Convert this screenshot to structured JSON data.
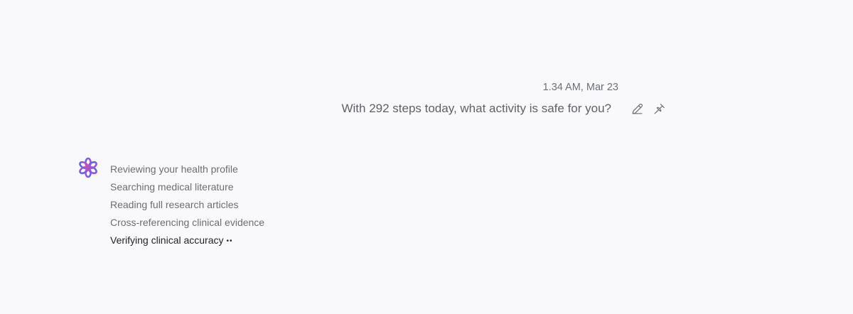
{
  "user_message": {
    "timestamp": "1.34 AM, Mar 23",
    "text": "With 292 steps today, what activity is safe for you?",
    "actions": [
      {
        "icon": "pencil-icon"
      },
      {
        "icon": "pin-icon"
      }
    ]
  },
  "assistant": {
    "logo_icon": "flower-logo-icon",
    "steps": [
      {
        "label": "Reviewing your health profile",
        "state": "done"
      },
      {
        "label": "Searching medical literature",
        "state": "done"
      },
      {
        "label": "Reading full research articles",
        "state": "done"
      },
      {
        "label": "Cross-referencing clinical evidence",
        "state": "done"
      },
      {
        "label": "Verifying clinical accuracy",
        "state": "active"
      }
    ],
    "progress_indicator": "••"
  },
  "colors": {
    "background": "#f9f9fb",
    "text_muted": "#5e6167",
    "text_active": "#1f2125",
    "logo_blue": "#4a6cf0",
    "logo_purple": "#9a52e0",
    "logo_pink": "#e3508a"
  }
}
